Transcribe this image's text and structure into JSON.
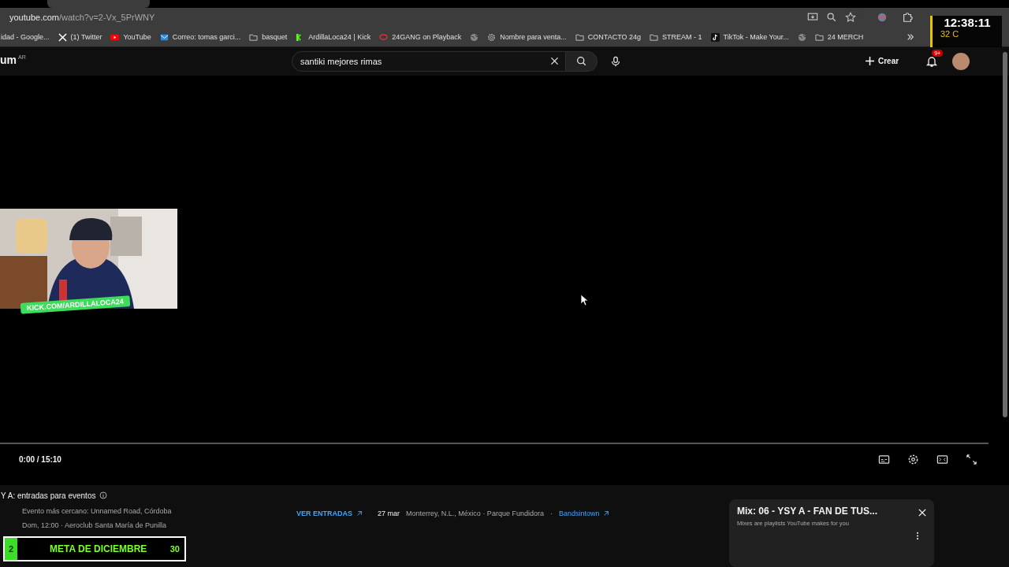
{
  "browser": {
    "url_host": "youtube.com",
    "url_path": "/watch?v=2-Vx_5PrWNY",
    "bookmarks": [
      {
        "label": "idad - Google...",
        "kind": "page"
      },
      {
        "label": "(1) Twitter",
        "kind": "x"
      },
      {
        "label": "YouTube",
        "kind": "youtube"
      },
      {
        "label": "Correo: tomas garci...",
        "kind": "mail"
      },
      {
        "label": "basquet",
        "kind": "folder"
      },
      {
        "label": "ArdillaLoca24 | Kick",
        "kind": "kick"
      },
      {
        "label": "24GANG on Playback",
        "kind": "playback"
      },
      {
        "kind": "globe"
      },
      {
        "label": "Nombre para venta...",
        "kind": "gear"
      },
      {
        "label": "CONTACTO 24g",
        "kind": "folder"
      },
      {
        "label": "STREAM - 1",
        "kind": "folder"
      },
      {
        "label": "TikTok - Make Your...",
        "kind": "tiktok"
      },
      {
        "kind": "globe"
      },
      {
        "label": "24 MERCH",
        "kind": "folder"
      }
    ]
  },
  "youtube": {
    "logo_text": "um",
    "region": "AR",
    "search": {
      "value": "santiki mejores rimas"
    },
    "create_label": "Crear",
    "notification_badge": "9+"
  },
  "player": {
    "time": "0:00 / 15:10",
    "progress": {
      "level": 0
    }
  },
  "events": {
    "title": "Y A: entradas para eventos",
    "nearest": {
      "line1": "Evento más cercano: Unnamed Road, Córdoba",
      "line2": "Dom, 12:00 · Aeroclub Santa María de Punilla"
    },
    "rows": [
      {
        "button": "VER ENTRADAS",
        "date": "27 mar",
        "place": "Monterrey, N.L., México · Parque Fundidora",
        "separator": "·",
        "source": "Bandsintown"
      }
    ]
  },
  "mix_card": {
    "title": "Mix: 06 - YSY A - FAN DE TUS...",
    "subtitle": "Mixes are playlists YouTube makes for you"
  },
  "stream_overlay": {
    "clock": "12:38:11",
    "temperature": "32 C",
    "webcam_banner": "KICK.COM/ARDILLALOCA24",
    "goal": {
      "label": "META DE DICIEMBRE",
      "current": "2",
      "target": "30",
      "level": 0.07
    }
  }
}
